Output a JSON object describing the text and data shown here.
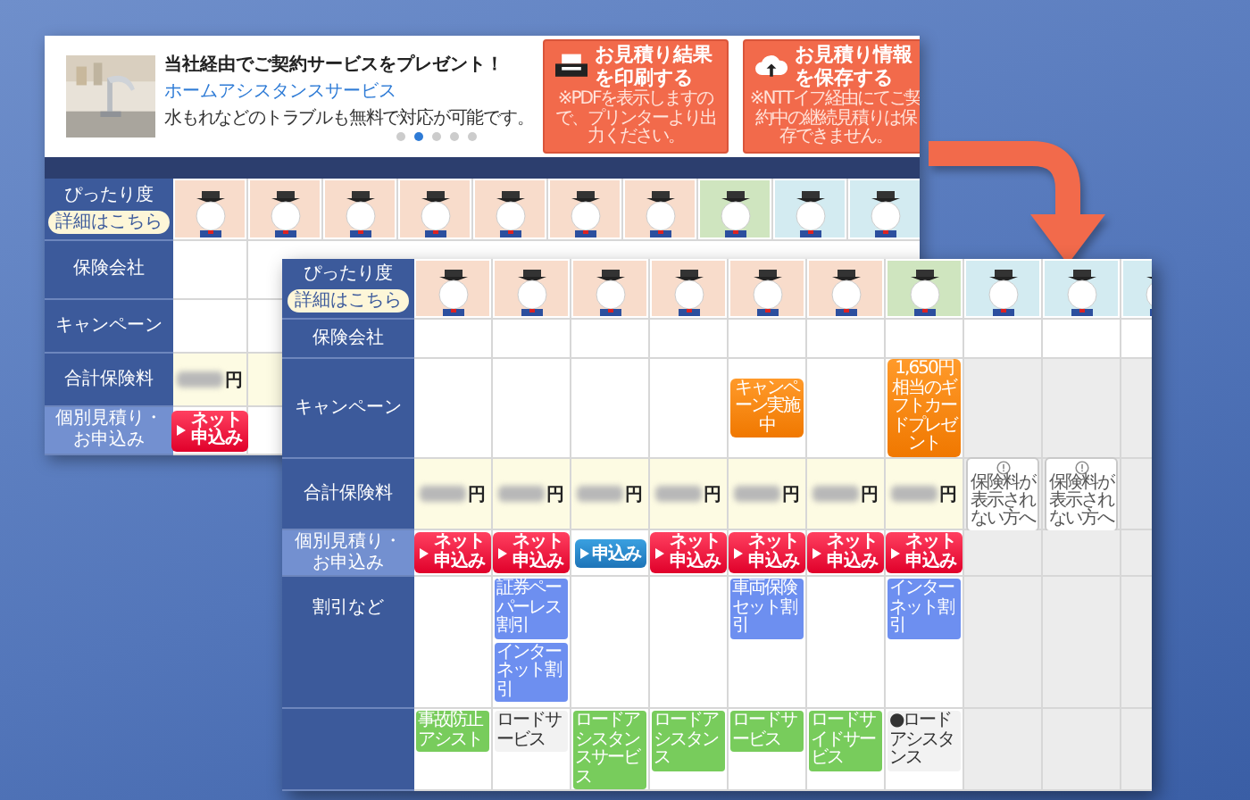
{
  "back_page": {
    "ad": {
      "headline": "当社経由でご契約サービスをプレゼント！",
      "service_link": "ホームアシスタンスサービス",
      "description": "水もれなどのトラブルも無料で対応が可能です。",
      "dots": [
        {
          "selected": false
        },
        {
          "selected": true
        },
        {
          "selected": false
        },
        {
          "selected": false
        },
        {
          "selected": false
        }
      ]
    },
    "buttons": [
      {
        "kind": "print",
        "title": "お見積り結果を印刷する",
        "note": "※PDFを表示しますので、プリンターより出力ください。"
      },
      {
        "kind": "save",
        "title": "お見積り情報を保存する",
        "note": "※NTTイフ経由にてご契約中の継続見積りは保存できません。"
      }
    ],
    "fit_label": "ぴったり度",
    "fit_link": "詳細はこちら",
    "row_labels": [
      "保険会社",
      "キャンペーン",
      "合計保険料",
      "個別見積り・お申込み"
    ],
    "columns": [
      {
        "color": "#f8dccb",
        "price": "円",
        "apply": "ネット申込み"
      },
      {
        "color": "#f8dccb"
      },
      {
        "color": "#f8dccb"
      },
      {
        "color": "#f8dccb"
      },
      {
        "color": "#f8dccb"
      },
      {
        "color": "#f8dccb"
      },
      {
        "color": "#f8dccb"
      },
      {
        "color": "#cfe5bf"
      },
      {
        "color": "#d3ebf1"
      },
      {
        "color": "#d3ebf1"
      }
    ]
  },
  "front_page": {
    "fit_label": "ぴったり度",
    "fit_link": "詳細はこちら",
    "row_labels": [
      "保険会社",
      "キャンペーン",
      "合計保険料",
      "個別見積り・お申込み",
      "割引など"
    ],
    "columns": [
      {
        "color": "#f8dccb",
        "price": {
          "kind": "amount",
          "text": "円"
        },
        "apply": {
          "kind": "net",
          "label": "ネット申込み"
        },
        "services": [
          {
            "kind": "green",
            "text": "事故防止アシスト"
          }
        ]
      },
      {
        "color": "#f8dccb",
        "price": {
          "kind": "amount",
          "text": "円"
        },
        "apply": {
          "kind": "net",
          "label": "ネット申込み"
        },
        "discounts": [
          "証券ペーパーレス割引",
          "インターネット割引"
        ],
        "services": [
          {
            "kind": "plain",
            "text": "ロードサービス"
          }
        ]
      },
      {
        "color": "#f8dccb",
        "price": {
          "kind": "amount",
          "text": "円"
        },
        "apply": {
          "kind": "plain",
          "label": "申込み"
        },
        "services": [
          {
            "kind": "green",
            "text": "ロードアシスタンスサービス"
          }
        ]
      },
      {
        "color": "#f8dccb",
        "price": {
          "kind": "amount",
          "text": "円"
        },
        "apply": {
          "kind": "net",
          "label": "ネット申込み"
        },
        "services": [
          {
            "kind": "green",
            "text": "ロードアシスタンス"
          }
        ]
      },
      {
        "color": "#f8dccb",
        "campaign": "キャンペーン実施中",
        "price": {
          "kind": "amount",
          "text": "円"
        },
        "apply": {
          "kind": "net",
          "label": "ネット申込み"
        },
        "discounts": [
          "車両保険セット割引"
        ],
        "services": [
          {
            "kind": "green",
            "text": "ロードサービス"
          }
        ]
      },
      {
        "color": "#f8dccb",
        "price": {
          "kind": "amount",
          "text": "円"
        },
        "apply": {
          "kind": "net",
          "label": "ネット申込み"
        },
        "services": [
          {
            "kind": "green",
            "text": "ロードサイドサービス"
          }
        ]
      },
      {
        "color": "#cfe5bf",
        "campaign": "1,650円相当のギフトカードプレゼント",
        "price": {
          "kind": "amount",
          "text": "円"
        },
        "apply": {
          "kind": "net",
          "label": "ネット申込み"
        },
        "discounts": [
          "インターネット割引"
        ],
        "services": [
          {
            "kind": "plain",
            "text": "●ロードアシスタンス"
          }
        ]
      },
      {
        "color": "#d3ebf1",
        "price": {
          "kind": "notice",
          "text": "保険料が表示されない方へ"
        }
      },
      {
        "color": "#d3ebf1",
        "price": {
          "kind": "notice",
          "text": "保険料が表示されない方へ"
        }
      },
      {
        "color": "#d3ebf1"
      }
    ]
  }
}
